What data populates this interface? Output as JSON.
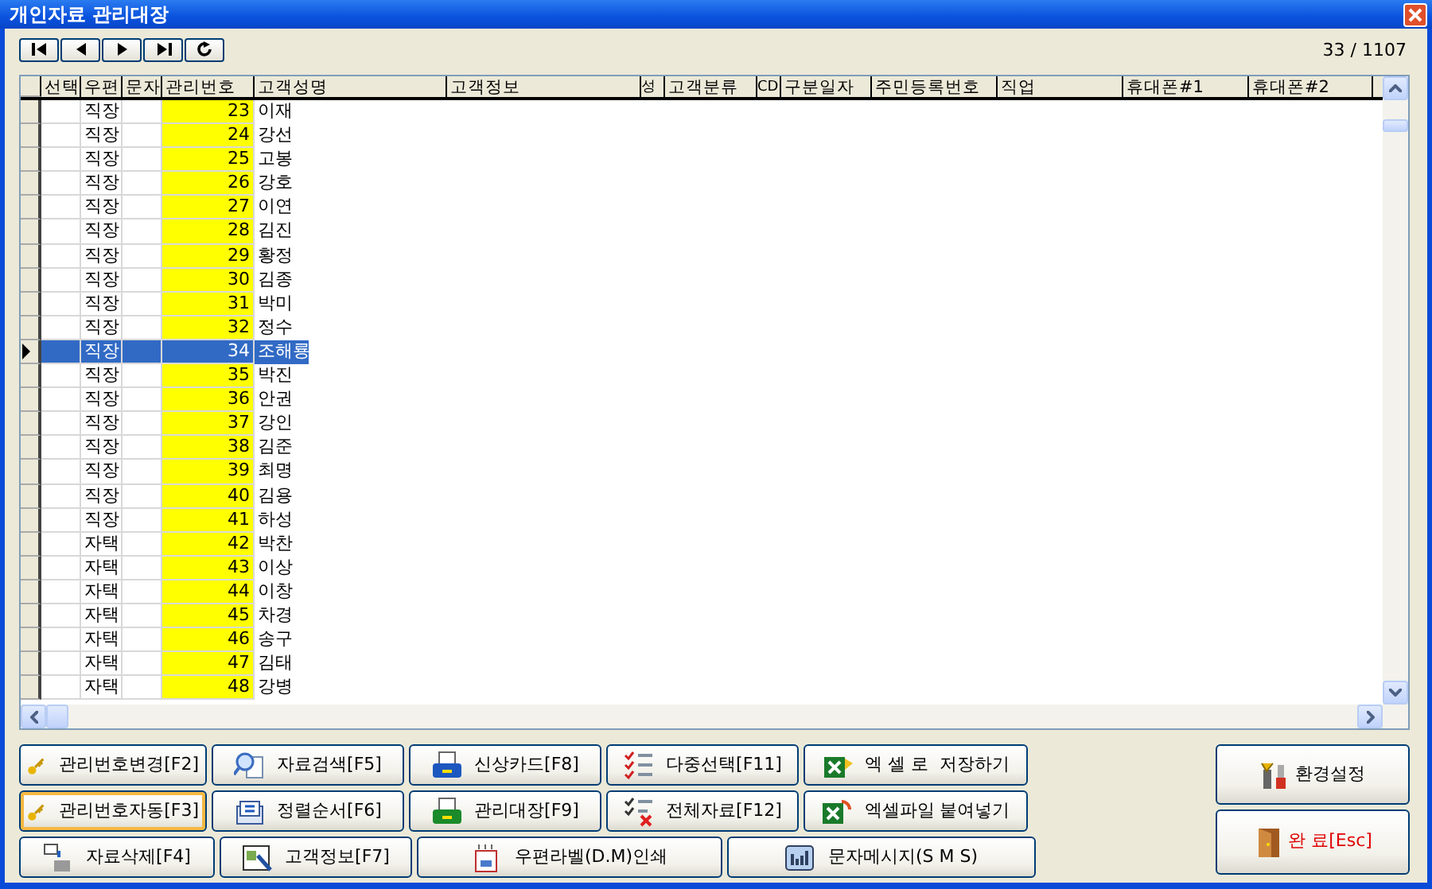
{
  "window": {
    "title": "개인자료 관리대장"
  },
  "record_counter": "33 / 1107",
  "table": {
    "columns": [
      "선택",
      "우편",
      "문자",
      "관리번호",
      "고객성명",
      "고객정보",
      "성",
      "고객분류",
      "CD",
      "구분일자",
      "주민등록번호",
      "직업",
      "휴대폰#1",
      "휴대폰#2"
    ],
    "rows": [
      {
        "postal": "직장",
        "number": "23",
        "name": "이재",
        "selected": false
      },
      {
        "postal": "직장",
        "number": "24",
        "name": "강선",
        "selected": false
      },
      {
        "postal": "직장",
        "number": "25",
        "name": "고봉",
        "selected": false
      },
      {
        "postal": "직장",
        "number": "26",
        "name": "강호",
        "selected": false
      },
      {
        "postal": "직장",
        "number": "27",
        "name": "이연",
        "selected": false
      },
      {
        "postal": "직장",
        "number": "28",
        "name": "김진",
        "selected": false
      },
      {
        "postal": "직장",
        "number": "29",
        "name": "황정",
        "selected": false
      },
      {
        "postal": "직장",
        "number": "30",
        "name": "김종",
        "selected": false
      },
      {
        "postal": "직장",
        "number": "31",
        "name": "박미",
        "selected": false
      },
      {
        "postal": "직장",
        "number": "32",
        "name": "정수",
        "selected": false
      },
      {
        "postal": "직장",
        "number": "34",
        "name": "조해룡",
        "selected": true
      },
      {
        "postal": "직장",
        "number": "35",
        "name": "박진",
        "selected": false
      },
      {
        "postal": "직장",
        "number": "36",
        "name": "안권",
        "selected": false
      },
      {
        "postal": "직장",
        "number": "37",
        "name": "강인",
        "selected": false
      },
      {
        "postal": "직장",
        "number": "38",
        "name": "김준",
        "selected": false
      },
      {
        "postal": "직장",
        "number": "39",
        "name": "최명",
        "selected": false
      },
      {
        "postal": "직장",
        "number": "40",
        "name": "김용",
        "selected": false
      },
      {
        "postal": "직장",
        "number": "41",
        "name": "하성",
        "selected": false
      },
      {
        "postal": "자택",
        "number": "42",
        "name": "박찬",
        "selected": false
      },
      {
        "postal": "자택",
        "number": "43",
        "name": "이상",
        "selected": false
      },
      {
        "postal": "자택",
        "number": "44",
        "name": "이창",
        "selected": false
      },
      {
        "postal": "자택",
        "number": "45",
        "name": "차경",
        "selected": false
      },
      {
        "postal": "자택",
        "number": "46",
        "name": "송구",
        "selected": false
      },
      {
        "postal": "자택",
        "number": "47",
        "name": "김태",
        "selected": false
      },
      {
        "postal": "자택",
        "number": "48",
        "name": "강병",
        "selected": false
      }
    ]
  },
  "button_rows": [
    [
      {
        "label": "관리번호변경[F2]",
        "hovered": false
      },
      {
        "label": "자료검색[F5]",
        "hovered": false
      },
      {
        "label": "신상카드[F8]",
        "hovered": false
      },
      {
        "label": "다중선택[F11]",
        "hovered": false
      },
      {
        "label": "엑 셀 로  저장하기",
        "hovered": false
      }
    ],
    [
      {
        "label": "관리번호자동[F3]",
        "hovered": true
      },
      {
        "label": "정렬순서[F6]",
        "hovered": false
      },
      {
        "label": "관리대장[F9]",
        "hovered": false
      },
      {
        "label": "전체자료[F12]",
        "hovered": false
      },
      {
        "label": "엑셀파일 붙여넣기",
        "hovered": false
      }
    ],
    [
      {
        "label": "자료삭제[F4]",
        "hovered": false
      },
      {
        "label": "고객정보[F7]",
        "hovered": false
      },
      {
        "label": "우편라벨(D.M)인쇄",
        "hovered": false
      },
      {
        "label": "문자메시지(S M S)",
        "hovered": false
      }
    ]
  ],
  "side_buttons": [
    {
      "label": "환경설정",
      "kind": "settings"
    },
    {
      "label": "완 료[Esc]",
      "kind": "exit"
    }
  ]
}
